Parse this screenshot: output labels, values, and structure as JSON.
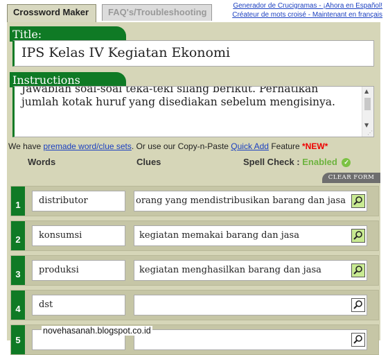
{
  "tabs": [
    {
      "label": "Crossword Maker"
    },
    {
      "label": "FAQ's/Troubleshooting"
    }
  ],
  "top_links": [
    "Generador de Crucigramas - ¡Ahora en Español!",
    "Créateur de mots croisé - Maintenant en français"
  ],
  "title_section": {
    "label": "Title:",
    "value": "IPS Kelas IV Kegiatan Ekonomi"
  },
  "instructions_section": {
    "label": "Instructions",
    "value": "Jawablah soal-soal teka-teki silang berikut. Perhatikan jumlah kotak huruf yang disediakan sebelum mengisinya."
  },
  "notice": {
    "prefix": "We have ",
    "link1": "premade word/clue sets",
    "middle": ". Or use our Copy-n-Paste ",
    "link2": "Quick Add",
    "suffix": " Feature ",
    "badge": "*NEW*"
  },
  "columns": {
    "words": "Words",
    "clues": "Clues",
    "spell_check_label": "Spell Check :",
    "spell_check_status": "Enabled"
  },
  "clear_form_label": "CLEAR FORM",
  "rows": [
    {
      "num": "1",
      "word": "distributor",
      "clue": "orang yang mendistribusikan barang dan jasa"
    },
    {
      "num": "2",
      "word": "konsumsi",
      "clue": "kegiatan memakai barang dan jasa"
    },
    {
      "num": "3",
      "word": "produksi",
      "clue": "kegiatan menghasilkan barang dan jasa"
    },
    {
      "num": "4",
      "word": "dst",
      "clue": ""
    },
    {
      "num": "5",
      "word": "",
      "clue": ""
    }
  ],
  "watermark": "novehasanah.blogspot.co.id",
  "colors": {
    "accent_green": "#0f7a25",
    "panel": "#d6d6b8",
    "link": "#1a3fc0"
  }
}
